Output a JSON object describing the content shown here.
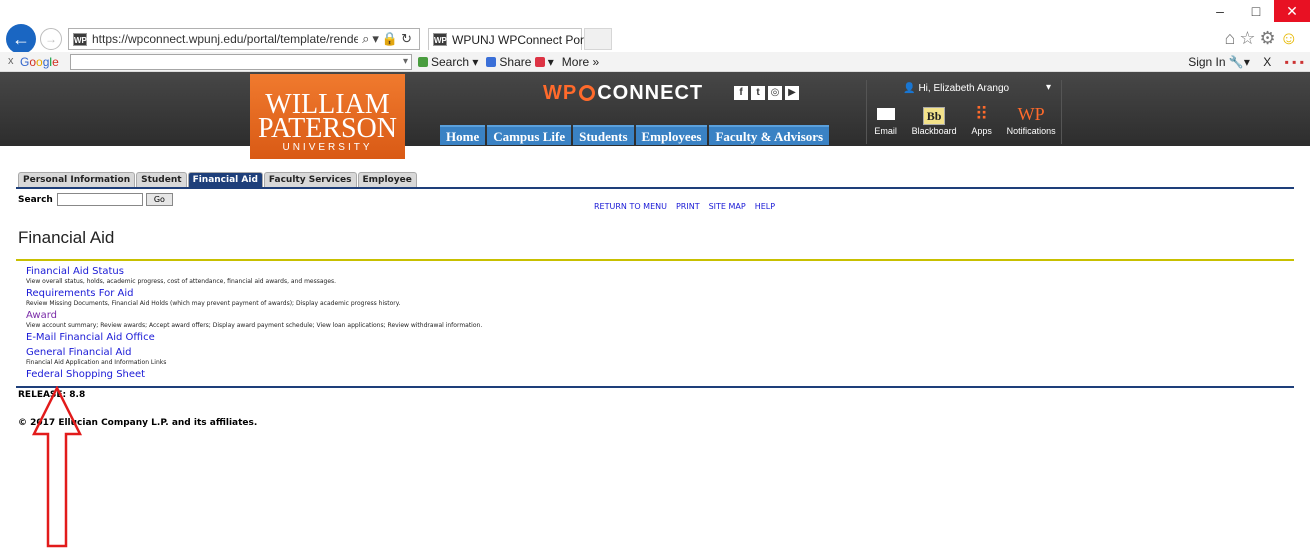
{
  "browser": {
    "address_url": "https://wpconnect.wpunj.edu/portal/template/render.cfm?",
    "favicon_text": "WP",
    "tab_title": "WPUNJ WPConnect Portal",
    "tab_close": "×",
    "window_controls": {
      "minimize": "–",
      "restore": "□",
      "close": "✕"
    }
  },
  "toolbar": {
    "close": "x",
    "google_parts": [
      "G",
      "o",
      "o",
      "g",
      "l",
      "e"
    ],
    "search_label": "Search ▾",
    "share_label": "Share",
    "more_label": "More »",
    "sign_in_label": "Sign In",
    "close_right": "X"
  },
  "site": {
    "logo": {
      "line1": "WILLIAM",
      "line2": "PATERSON",
      "line3": "UNIVERSITY"
    },
    "brand_wp": "WP",
    "brand_connect": "CONNECT",
    "social_icons": [
      "facebook-icon",
      "twitter-icon",
      "instagram-icon",
      "youtube-icon"
    ],
    "nav": [
      "Home",
      "Campus Life",
      "Students",
      "Employees",
      "Faculty & Advisors"
    ],
    "user_greeting": "Hi, Elizabeth Arango",
    "apps": [
      {
        "label": "Email",
        "icon": "envelope-icon"
      },
      {
        "label": "Blackboard",
        "icon": "blackboard-icon",
        "glyph": "Bb"
      },
      {
        "label": "Apps",
        "icon": "apps-grid-icon"
      },
      {
        "label": "Notifications",
        "icon": "wp-notifications-icon",
        "glyph": "WP"
      }
    ],
    "accent_orange": "#e86b22",
    "nav_blue": "#3a82c4"
  },
  "page": {
    "tabs": [
      "Personal Information",
      "Student",
      "Financial Aid",
      "Faculty Services",
      "Employee"
    ],
    "active_tab": "Financial Aid",
    "search_label": "Search",
    "go_label": "Go",
    "menu_links": [
      "RETURN TO MENU",
      "PRINT",
      "SITE MAP",
      "HELP"
    ],
    "title": "Financial Aid",
    "items": [
      {
        "link": "Financial Aid Status",
        "desc": "View overall status, holds, academic progress, cost of attendance, financial aid awards, and messages."
      },
      {
        "link": "Requirements For Aid",
        "desc": "Review Missing Documents, Financial Aid Holds (which may prevent payment of awards); Display academic progress history."
      },
      {
        "link": "Award",
        "desc": "View account summary; Review awards; Accept award offers; Display award payment schedule; View loan applications; Review withdrawal information."
      },
      {
        "link": "E-Mail Financial Aid Office",
        "desc": ""
      },
      {
        "link": "General Financial Aid",
        "desc": "Financial Aid Application and Information Links"
      },
      {
        "link": "Federal Shopping Sheet",
        "desc": ""
      }
    ],
    "release": "RELEASE: 8.8",
    "copyright": "© 2017 Ellucian Company L.P. and its affiliates."
  }
}
